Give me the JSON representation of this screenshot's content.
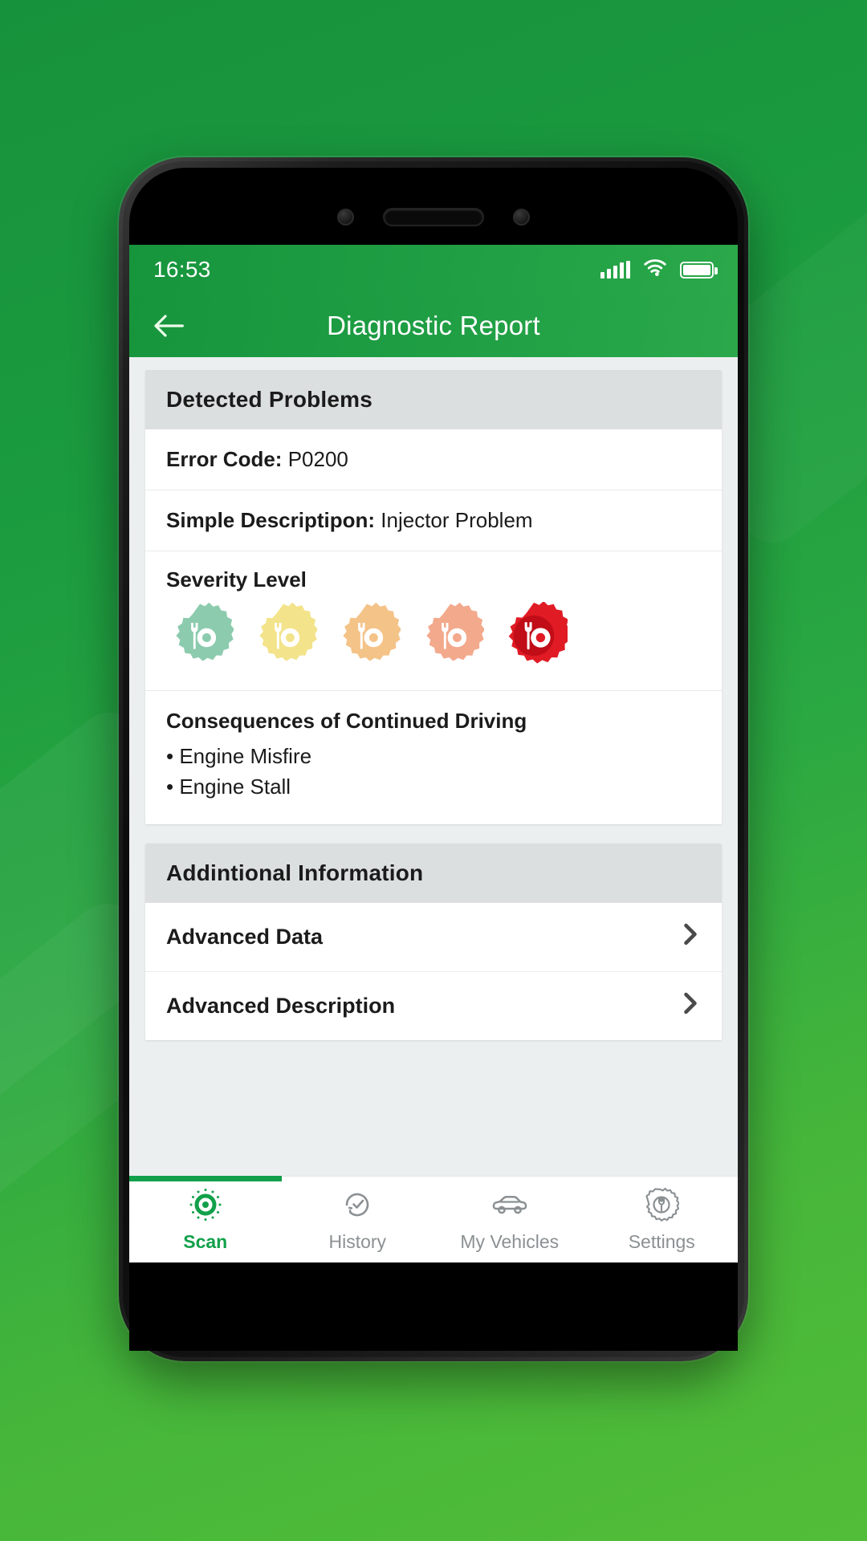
{
  "statusbar": {
    "time": "16:53",
    "signal_icon": "signal-bars-icon",
    "wifi_icon": "wifi-icon",
    "battery_icon": "battery-full-icon"
  },
  "appbar": {
    "back_icon": "back-arrow-icon",
    "title": "Diagnostic Report"
  },
  "detected_problems": {
    "header": "Detected Problems",
    "error_code_label": "Error Code:",
    "error_code_value": "P0200",
    "description_label": "Simple Descriptipon:",
    "description_value": "Injector Problem",
    "severity_title": "Severity Level",
    "severity_selected": 5,
    "severity_colors": [
      "#8ccbae",
      "#f3e38a",
      "#f4c388",
      "#f3a98c",
      "#e01b24"
    ],
    "consequences_title": "Consequences of Continued Driving",
    "consequences": [
      "• Engine Misfire",
      "• Engine Stall"
    ]
  },
  "additional_information": {
    "header": "Addintional Information",
    "items": [
      {
        "label": "Advanced Data",
        "chevron_icon": "chevron-right-icon"
      },
      {
        "label": "Advanced Description",
        "chevron_icon": "chevron-right-icon"
      }
    ]
  },
  "tabbar": {
    "active_index": 0,
    "accent_color": "#12a04a",
    "inactive_color": "#8b9093",
    "tabs": [
      {
        "label": "Scan",
        "icon": "scan-target-icon"
      },
      {
        "label": "History",
        "icon": "clock-history-icon"
      },
      {
        "label": "My Vehicles",
        "icon": "car-icon"
      },
      {
        "label": "Settings",
        "icon": "gear-wrench-icon"
      }
    ]
  }
}
